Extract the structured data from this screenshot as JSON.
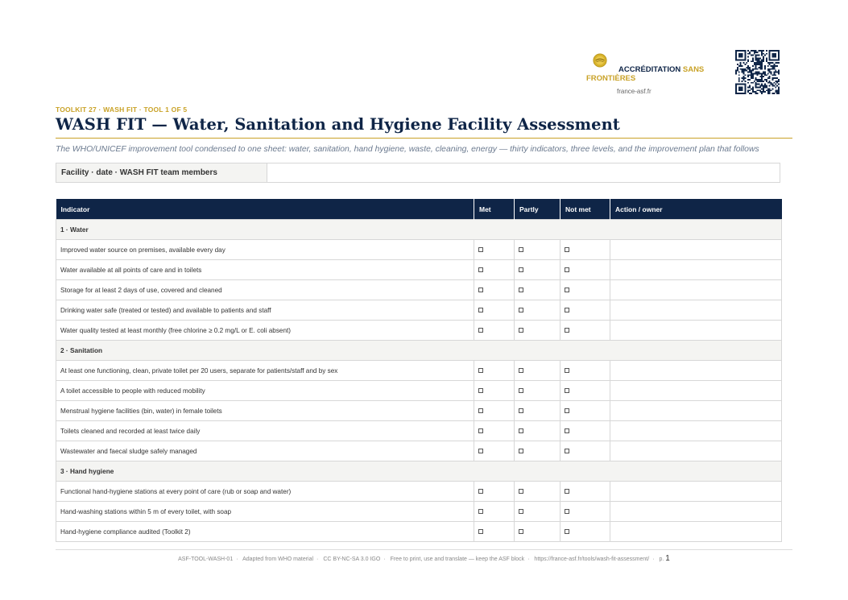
{
  "brand": {
    "name_part1": "ACCRÉDITATION",
    "name_part2": "SANS FRONTIÈRES",
    "site": "france-asf.fr",
    "accent_color": "#c9a227",
    "navy_color": "#0f2547"
  },
  "header": {
    "kicker": "TOOLKIT 27 · WASH FIT · TOOL 1 OF 5",
    "title": "WASH FIT — Water, Sanitation and Hygiene Facility Assessment",
    "subtitle": "The WHO/UNICEF improvement tool condensed to one sheet: water, sanitation, hand hygiene, waste, cleaning, energy — thirty indicators, three levels, and the improvement plan that follows"
  },
  "facility": {
    "label": "Facility · date · WASH FIT team members",
    "value": ""
  },
  "table": {
    "headers": [
      "Indicator",
      "Met",
      "Partly",
      "Not met",
      "Action / owner"
    ],
    "sections": [
      {
        "title": "1 · Water",
        "rows": [
          "Improved water source on premises, available every day",
          "Water available at all points of care and in toilets",
          "Storage for at least 2 days of use, covered and cleaned",
          "Drinking water safe (treated or tested) and available to patients and staff",
          "Water quality tested at least monthly (free chlorine ≥ 0.2 mg/L or E. coli absent)"
        ]
      },
      {
        "title": "2 · Sanitation",
        "rows": [
          "At least one functioning, clean, private toilet per 20 users, separate for patients/staff and by sex",
          "A toilet accessible to people with reduced mobility",
          "Menstrual hygiene facilities (bin, water) in female toilets",
          "Toilets cleaned and recorded at least twice daily",
          "Wastewater and faecal sludge safely managed"
        ]
      },
      {
        "title": "3 · Hand hygiene",
        "rows": [
          "Functional hand-hygiene stations at every point of care (rub or soap and water)",
          "Hand-washing stations within 5 m of every toilet, with soap",
          "Hand-hygiene compliance audited (Toolkit 2)"
        ]
      }
    ]
  },
  "footer": {
    "items": [
      "ASF-TOOL-WASH-01",
      "Adapted from WHO material",
      "CC BY-NC-SA 3.0 IGO",
      "Free to print, use and translate — keep the ASF block",
      "https://france-asf.fr/tools/wash-fit-assessment/"
    ],
    "page_prefix": "p.",
    "page_number": "1"
  }
}
